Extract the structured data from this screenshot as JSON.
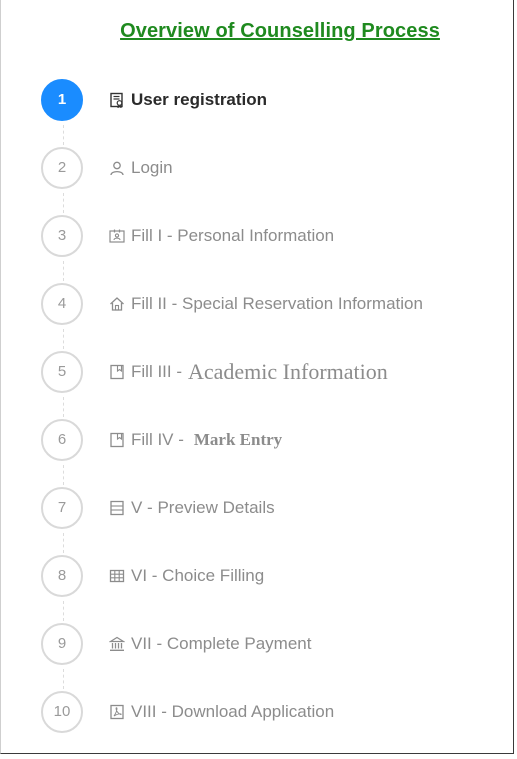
{
  "title": "Overview of Counselling Process",
  "colors": {
    "title": "#1f8a1f",
    "active": "#1a8cff",
    "inactive_text": "#8c8c8c",
    "active_text": "#2a2a2a"
  },
  "steps": [
    {
      "number": "1",
      "icon": "id-badge-icon",
      "label": "User registration",
      "active": true
    },
    {
      "number": "2",
      "icon": "user-icon",
      "label": "Login"
    },
    {
      "number": "3",
      "icon": "id-card-icon",
      "label": "Fill I - Personal Information"
    },
    {
      "number": "4",
      "icon": "home-icon",
      "label": "Fill II - Special Reservation Information"
    },
    {
      "number": "5",
      "icon": "book-icon",
      "label": "Fill III -",
      "label_suffix": "Academic Information"
    },
    {
      "number": "6",
      "icon": "book-icon",
      "label": "Fill IV -",
      "label_suffix": "Mark Entry"
    },
    {
      "number": "7",
      "icon": "list-icon",
      "label": "V - Preview Details"
    },
    {
      "number": "8",
      "icon": "table-icon",
      "label": "VI - Choice Filling"
    },
    {
      "number": "9",
      "icon": "bank-icon",
      "label": "VII - Complete Payment"
    },
    {
      "number": "10",
      "icon": "pdf-icon",
      "label": "VIII - Download Application"
    }
  ]
}
